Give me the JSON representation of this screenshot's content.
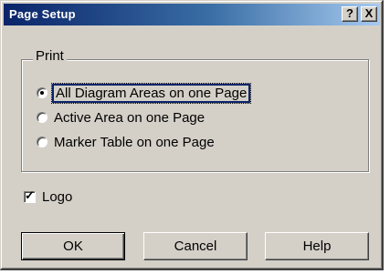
{
  "window": {
    "title": "Page Setup",
    "help_button": "?",
    "close_button": "X"
  },
  "print_group": {
    "label": "Print",
    "options": [
      {
        "label": "All Diagram Areas on one Page",
        "selected": true
      },
      {
        "label": "Active Area on one Page",
        "selected": false
      },
      {
        "label": "Marker Table on one Page",
        "selected": false
      }
    ]
  },
  "logo_checkbox": {
    "label": "Logo",
    "checked": true
  },
  "buttons": {
    "ok": "OK",
    "cancel": "Cancel",
    "help": "Help"
  },
  "colors": {
    "titlebar_start": "#0a246a",
    "titlebar_end": "#a6caf0",
    "dialog_face": "#d4d0c8"
  }
}
